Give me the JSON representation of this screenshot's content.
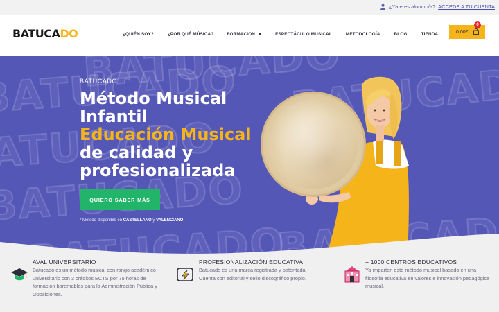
{
  "topbar": {
    "question": "¿Ya eres alumno/a?",
    "link": "ACCEDE A TU CUENTA"
  },
  "header": {
    "logo_part1": "BATUCA",
    "logo_part2": "DO",
    "nav": [
      {
        "label": "¿QUIÉN SOY?"
      },
      {
        "label": "¿POR QUÉ MÚSICA?"
      },
      {
        "label": "FORMACION"
      },
      {
        "label": "ESPECTÁCULO MUSICAL"
      },
      {
        "label": "METODOLOGÍA"
      },
      {
        "label": "BLOG"
      },
      {
        "label": "TIENDA"
      }
    ],
    "cart_total": "0,00€",
    "cart_count": "0"
  },
  "hero": {
    "kicker": "BATUCADO",
    "line1": "Método Musical",
    "line2": "Infantil",
    "line3": "Educación Musical",
    "line4": "de calidad y",
    "line5": "profesionalizada",
    "cta": "QUIERO SABER MÁS",
    "note_prefix": "* Método disponible en ",
    "note_lang1": "CASTELLANO",
    "note_and": " y ",
    "note_lang2": "VALENCIANO",
    "watermark": "BATUCADO"
  },
  "features": [
    {
      "title": "AVAL UNIVERSITARIO",
      "desc": "Batucado es un método musical con rango académico universitario con 3 créditos ECTS por 75 horas de formación baremables para la Administración Pública y Oposiciones."
    },
    {
      "title": "PROFESIONALIZACIÓN EDUCATIVA",
      "desc": "Batucado es una marca registrada y patentada. Cuenta con editorial y sello discográfico propio."
    },
    {
      "title": "+ 1000 CENTROS EDUCATIVOS",
      "desc": "Ya imparten este método musical basado en una filosofía educativa en valores e innovación pedagógica musical."
    }
  ],
  "colors": {
    "hero_bg": "#5557b7",
    "accent_yellow": "#f5b41a",
    "cta_green": "#22b56a",
    "badge_red": "#e8262a"
  }
}
